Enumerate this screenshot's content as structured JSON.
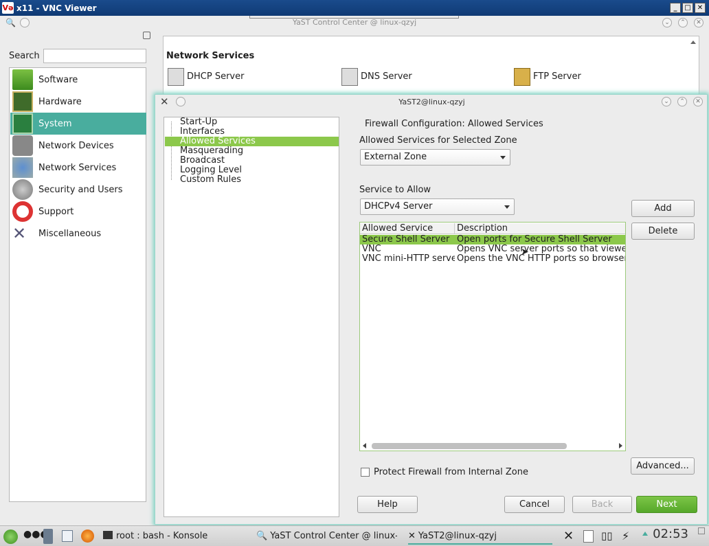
{
  "vnc": {
    "title": "x11 - VNC Viewer",
    "logo": "Və"
  },
  "ycc": {
    "title": "YaST Control Center @ linux-qzyj",
    "search_label": "Search",
    "search_placeholder": "",
    "categories": [
      {
        "label": "Software",
        "icon": "software-icon"
      },
      {
        "label": "Hardware",
        "icon": "hardware-icon"
      },
      {
        "label": "System",
        "icon": "system-icon",
        "selected": true
      },
      {
        "label": "Network Devices",
        "icon": "network-devices-icon"
      },
      {
        "label": "Network Services",
        "icon": "network-services-icon"
      },
      {
        "label": "Security and Users",
        "icon": "security-users-icon"
      },
      {
        "label": "Support",
        "icon": "support-icon"
      },
      {
        "label": "Miscellaneous",
        "icon": "miscellaneous-icon"
      }
    ],
    "section_heading": "Network Services",
    "modules": [
      {
        "label": "DHCP Server",
        "icon": "dhcp-server-icon"
      },
      {
        "label": "DNS Server",
        "icon": "dns-server-icon"
      },
      {
        "label": "FTP Server",
        "icon": "ftp-server-icon"
      }
    ]
  },
  "dialog": {
    "title": "YaST2@linux-qzyj",
    "tree": [
      "Start-Up",
      "Interfaces",
      "Allowed Services",
      "Masquerading",
      "Broadcast",
      "Logging Level",
      "Custom Rules"
    ],
    "tree_selected": "Allowed Services",
    "heading": "Firewall Configuration: Allowed Services",
    "zone_label": "Allowed Services for Selected Zone",
    "zone_value": "External Zone",
    "service_label": "Service to Allow",
    "service_value": "DHCPv4 Server",
    "add": "Add",
    "delete": "Delete",
    "table": {
      "headers": [
        "Allowed Service",
        "Description"
      ],
      "rows": [
        [
          "Secure Shell Server",
          "Open ports for Secure Shell Server"
        ],
        [
          "VNC",
          "Opens VNC server ports so that viewers"
        ],
        [
          "VNC mini-HTTP server",
          "Opens the VNC HTTP ports so browsers"
        ]
      ],
      "selected_row": 0
    },
    "protect_label": "Protect Firewall from Internal Zone",
    "protect_checked": false,
    "advanced": "Advanced...",
    "help": "Help",
    "cancel": "Cancel",
    "back": "Back",
    "next": "Next"
  },
  "taskbar": {
    "tasks": [
      "root : bash - Konsole",
      "YaST Control Center @ linux-q",
      "YaST2@linux-qzyj"
    ],
    "clock": "02:53"
  },
  "colors": {
    "selection_green": "#8cc84b",
    "category_teal": "#49ad9e",
    "primary_button": "#5fb030"
  }
}
